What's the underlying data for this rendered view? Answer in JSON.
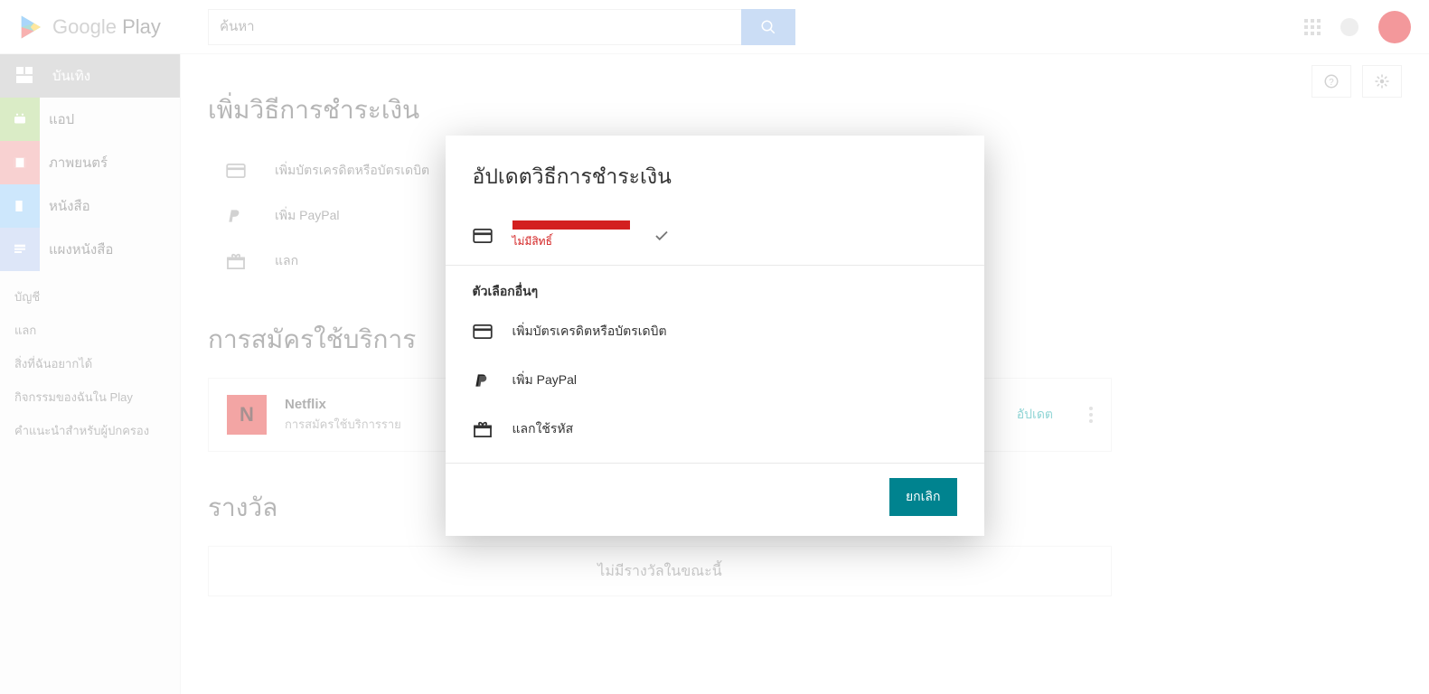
{
  "header": {
    "logo_text_a": "Google",
    "logo_text_b": " Play",
    "search_placeholder": "ค้นหา"
  },
  "sidebar": {
    "items": [
      {
        "label": "บันเทิง"
      },
      {
        "label": "แอป"
      },
      {
        "label": "ภาพยนตร์"
      },
      {
        "label": "หนังสือ"
      },
      {
        "label": "แผงหนังสือ"
      }
    ],
    "links": [
      {
        "label": "บัญชี"
      },
      {
        "label": "แลก"
      },
      {
        "label": "สิ่งที่ฉันอยากได้"
      },
      {
        "label": "กิจกรรมของฉันใน Play"
      },
      {
        "label": "คำแนะนำสำหรับผู้ปกครอง"
      }
    ]
  },
  "content": {
    "payment_title": "เพิ่มวิธีการชำระเงิน",
    "pm": [
      {
        "label": "เพิ่มบัตรเครดิตหรือบัตรเดบิต"
      },
      {
        "label": "เพิ่ม PayPal"
      },
      {
        "label": "แลก"
      }
    ],
    "subs_title": "การสมัครใช้บริการ",
    "sub": {
      "name": "Netflix",
      "desc": "การสมัครใช้บริการราย",
      "update": "อัปเดต",
      "thumb_glyph": "N"
    },
    "rewards_title": "รางวัล",
    "rewards_empty": "ไม่มีรางวัลในขณะนี้"
  },
  "modal": {
    "title": "อัปเดตวิธีการชำระเงิน",
    "card_error": "ไม่มีสิทธิ์",
    "other_header": "ตัวเลือกอื่นๆ",
    "options": [
      {
        "label": "เพิ่มบัตรเครดิตหรือบัตรเดบิต"
      },
      {
        "label": "เพิ่ม PayPal"
      },
      {
        "label": "แลกใช้รหัส"
      }
    ],
    "cancel": "ยกเลิก"
  }
}
